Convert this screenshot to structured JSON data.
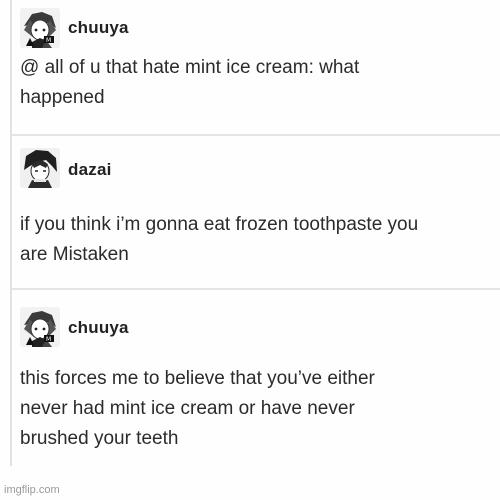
{
  "posts": [
    {
      "username": "chuuya",
      "avatar_icon": "chuuya-avatar-icon",
      "text": "@ all of u that hate mint ice cream: what\nhappened"
    },
    {
      "username": "dazai",
      "avatar_icon": "dazai-avatar-icon",
      "text": "if you think i’m gonna eat frozen toothpaste you\nare Mistaken"
    },
    {
      "username": "chuuya",
      "avatar_icon": "chuuya-avatar-icon",
      "text": "this forces me to believe that you’ve either\nnever had mint ice cream or have never\nbrushed your teeth"
    }
  ],
  "watermark": "imgflip.com"
}
